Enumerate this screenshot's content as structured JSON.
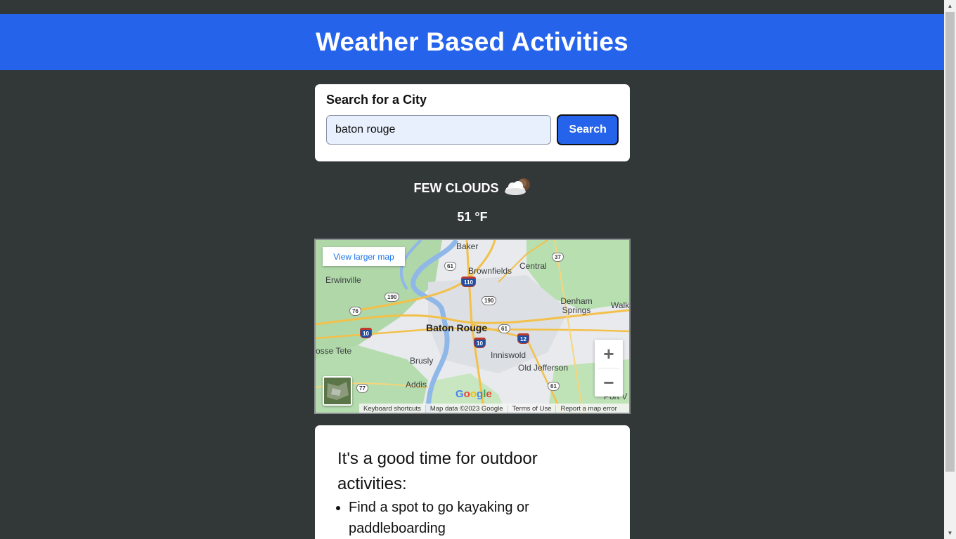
{
  "header": {
    "title": "Weather Based Activities"
  },
  "search": {
    "heading": "Search for a City",
    "input_value": "baton rouge",
    "button_label": "Search"
  },
  "weather": {
    "description": "FEW CLOUDS",
    "icon": "few-clouds-icon",
    "temperature": "51 °F"
  },
  "map": {
    "view_larger_label": "View larger map",
    "zoom_in": "+",
    "zoom_out": "−",
    "logo": "Google",
    "attribution": [
      "Keyboard shortcuts",
      "Map data ©2023 Google",
      "Terms of Use",
      "Report a map error"
    ],
    "places": [
      "Baker",
      "Brownfields",
      "Central",
      "Erwinville",
      "Denham Springs",
      "Walk",
      "Baton Rouge",
      "osse Tete",
      "Inniswold",
      "Brusly",
      "Old Jefferson",
      "Addis",
      "Port V"
    ],
    "routes": [
      "61",
      "110",
      "37",
      "190",
      "190",
      "76",
      "10",
      "61",
      "10",
      "12",
      "77",
      "61"
    ]
  },
  "activities": {
    "heading": "It's a good time for outdoor activities:",
    "items": [
      "Find a spot to go kayaking or paddleboarding"
    ]
  },
  "colors": {
    "header": "#2563eb",
    "background": "#323738",
    "button": "#2563eb"
  }
}
